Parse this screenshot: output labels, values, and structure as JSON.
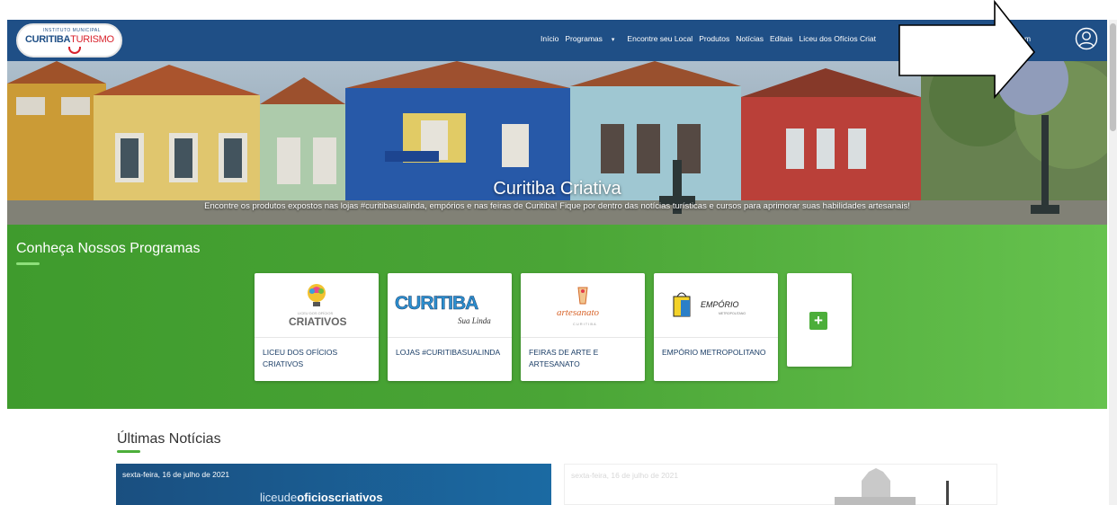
{
  "navbar": {
    "logo_small": "INSTITUTO MUNICIPAL",
    "logo_part1": "CURITIBA",
    "logo_part2": "TURISMO",
    "links": [
      "Início",
      "Programas",
      "Encontre seu Local",
      "Produtos",
      "Notícias",
      "Editais",
      "Liceu dos Ofícios Criat"
    ],
    "hidden_tail": "m"
  },
  "hero": {
    "title": "Curitiba Criativa",
    "subtitle": "Encontre os produtos expostos nas lojas #curitibasualinda, empórios e nas feiras de Curitiba! Fique por dentro das notícias turísticas e cursos para aprimorar suas habilidades artesanais!"
  },
  "programs": {
    "title": "Conheça Nossos Programas",
    "cards": [
      {
        "label": "LICEU DOS OFÍCIOS CRIATIVOS",
        "logo_text": "CRIATIVOS",
        "logo_small": "LICEU DOS OFÍCIOS"
      },
      {
        "label": "LOJAS #CURITIBASUALINDA",
        "logo_text": "CURITIBA",
        "logo_small": "Sua Linda"
      },
      {
        "label": "FEIRAS DE ARTE E ARTESANATO",
        "logo_text": "artesanato",
        "logo_small": "CURITIBA"
      },
      {
        "label": "EMPÓRIO METROPOLITANO",
        "logo_text": "EMPÓRIO",
        "logo_small": "METROPOLITANO"
      }
    ],
    "plus_label": "+"
  },
  "news": {
    "title": "Últimas Notícias",
    "items": [
      {
        "date": "sexta-feira, 16 de julho de 2021",
        "brand_prefix": "liceude",
        "brand_bold": "oficioscriativos"
      },
      {
        "date": "sexta-feira, 16 de julho de 2021"
      }
    ]
  },
  "colors": {
    "navbar": "#1f4f86",
    "green": "#4aa536",
    "accent_red": "#d9232d"
  }
}
